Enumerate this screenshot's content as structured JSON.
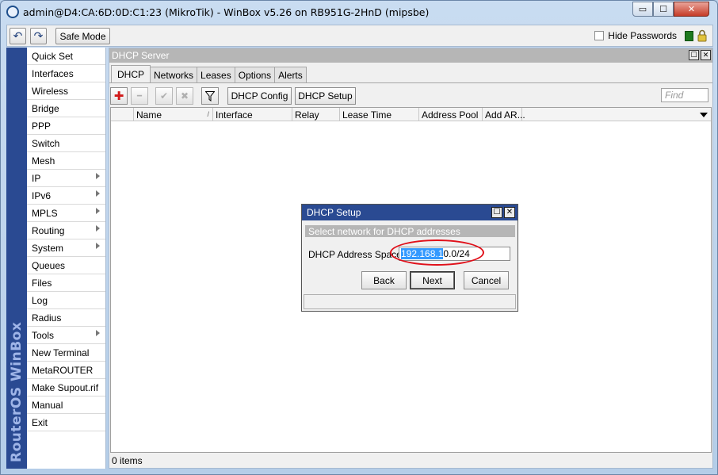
{
  "window": {
    "title": "admin@D4:CA:6D:0D:C1:23 (MikroTik) - WinBox v5.26 on RB951G-2HnD (mipsbe)",
    "min_glyph": "▭",
    "max_glyph": "☐",
    "close_glyph": "✕"
  },
  "toolbar": {
    "undo_glyph": "↶",
    "redo_glyph": "↷",
    "safe_mode": "Safe Mode",
    "hide_passwords": "Hide Passwords"
  },
  "brand": "RouterOS WinBox",
  "sidebar": {
    "items": [
      {
        "label": "Quick Set",
        "sub": false
      },
      {
        "label": "Interfaces",
        "sub": false
      },
      {
        "label": "Wireless",
        "sub": false
      },
      {
        "label": "Bridge",
        "sub": false
      },
      {
        "label": "PPP",
        "sub": false
      },
      {
        "label": "Switch",
        "sub": false
      },
      {
        "label": "Mesh",
        "sub": false
      },
      {
        "label": "IP",
        "sub": true
      },
      {
        "label": "IPv6",
        "sub": true
      },
      {
        "label": "MPLS",
        "sub": true
      },
      {
        "label": "Routing",
        "sub": true
      },
      {
        "label": "System",
        "sub": true
      },
      {
        "label": "Queues",
        "sub": false
      },
      {
        "label": "Files",
        "sub": false
      },
      {
        "label": "Log",
        "sub": false
      },
      {
        "label": "Radius",
        "sub": false
      },
      {
        "label": "Tools",
        "sub": true
      },
      {
        "label": "New Terminal",
        "sub": false
      },
      {
        "label": "MetaROUTER",
        "sub": false
      },
      {
        "label": "Make Supout.rif",
        "sub": false
      },
      {
        "label": "Manual",
        "sub": false
      },
      {
        "label": "Exit",
        "sub": false
      }
    ]
  },
  "dhcp_server": {
    "title": "DHCP Server",
    "tabs": [
      "DHCP",
      "Networks",
      "Leases",
      "Options",
      "Alerts"
    ],
    "active_tab": "DHCP",
    "buttons": {
      "add_glyph": "✚",
      "remove_glyph": "━",
      "enable_glyph": "✔",
      "disable_glyph": "✖",
      "filter_glyph": "▼",
      "dhcp_config": "DHCP Config",
      "dhcp_setup": "DHCP Setup"
    },
    "find_placeholder": "Find",
    "columns": [
      "Name",
      "Interface",
      "Relay",
      "Lease Time",
      "Address Pool",
      "Add AR..."
    ],
    "sort_glyph": "/",
    "status": "0 items"
  },
  "dialog": {
    "title": "DHCP Setup",
    "subtitle": "Select network for DHCP addresses",
    "label": "DHCP Address Space:",
    "value_selected": "192.168.1",
    "value_rest": "0.0/24",
    "back": "Back",
    "next": "Next",
    "cancel": "Cancel"
  },
  "colors": {
    "brand_bar": "#2a4a92",
    "annotation_oval": "#e0101a",
    "add_red": "#d11a1a",
    "selection": "#3399ff"
  }
}
